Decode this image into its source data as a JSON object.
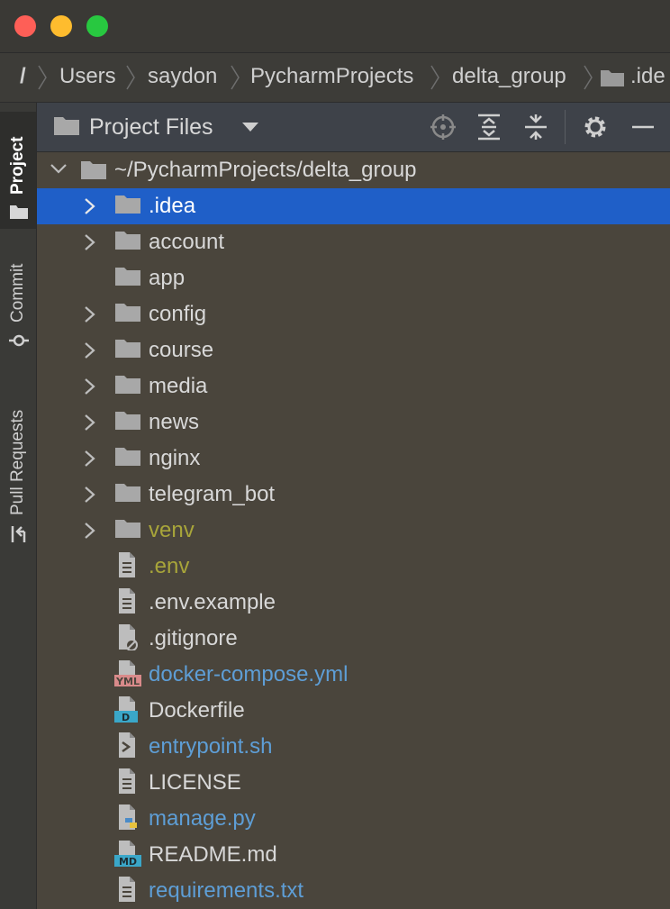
{
  "window": {
    "controls": [
      "close",
      "minimize",
      "maximize"
    ]
  },
  "breadcrumb": {
    "root": "/",
    "items": [
      "Users",
      "saydon",
      "PycharmProjects",
      "delta_group"
    ],
    "last_partial": ".ide"
  },
  "toolwindow_strip": {
    "tabs": [
      {
        "label": "Project",
        "icon": "folder-icon",
        "active": true
      },
      {
        "label": "Commit",
        "icon": "commit-icon",
        "active": false
      },
      {
        "label": "Pull Requests",
        "icon": "pull-request-icon",
        "active": false
      }
    ]
  },
  "panel": {
    "title": "Project Files",
    "toolbar_icons": [
      "locate-icon",
      "expand-all-icon",
      "collapse-all-icon",
      "gear-icon",
      "minimize-icon"
    ]
  },
  "tree": {
    "root": {
      "label": "~/PycharmProjects/delta_group",
      "expanded": true
    },
    "items": [
      {
        "label": ".idea",
        "kind": "folder",
        "expandable": true,
        "selected": true,
        "color": "white"
      },
      {
        "label": "account",
        "kind": "folder",
        "expandable": true,
        "color": "normal"
      },
      {
        "label": "app",
        "kind": "folder",
        "expandable": false,
        "color": "normal"
      },
      {
        "label": "config",
        "kind": "folder",
        "expandable": true,
        "color": "normal"
      },
      {
        "label": "course",
        "kind": "folder",
        "expandable": true,
        "color": "normal"
      },
      {
        "label": "media",
        "kind": "folder",
        "expandable": true,
        "color": "normal"
      },
      {
        "label": "news",
        "kind": "folder",
        "expandable": true,
        "color": "normal"
      },
      {
        "label": "nginx",
        "kind": "folder",
        "expandable": true,
        "color": "normal"
      },
      {
        "label": "telegram_bot",
        "kind": "folder",
        "expandable": true,
        "color": "normal"
      },
      {
        "label": "venv",
        "kind": "folder",
        "expandable": true,
        "color": "olive"
      },
      {
        "label": ".env",
        "kind": "file-text",
        "color": "olive"
      },
      {
        "label": ".env.example",
        "kind": "file-text",
        "color": "normal"
      },
      {
        "label": ".gitignore",
        "kind": "file-ignore",
        "color": "normal"
      },
      {
        "label": "docker-compose.yml",
        "kind": "file-yml",
        "badge": "YML",
        "color": "blue"
      },
      {
        "label": "Dockerfile",
        "kind": "file-docker",
        "badge": "D",
        "color": "normal"
      },
      {
        "label": "entrypoint.sh",
        "kind": "file-shell",
        "color": "blue"
      },
      {
        "label": "LICENSE",
        "kind": "file-text",
        "color": "normal"
      },
      {
        "label": "manage.py",
        "kind": "file-python",
        "color": "blue"
      },
      {
        "label": "README.md",
        "kind": "file-md",
        "badge": "MD",
        "color": "normal"
      },
      {
        "label": "requirements.txt",
        "kind": "file-text",
        "color": "blue"
      }
    ]
  },
  "colors": {
    "background": "#4a453c",
    "selection": "#1f5fc8",
    "modified_blue": "#5e9ed6",
    "ignored_olive": "#a8a53a"
  }
}
